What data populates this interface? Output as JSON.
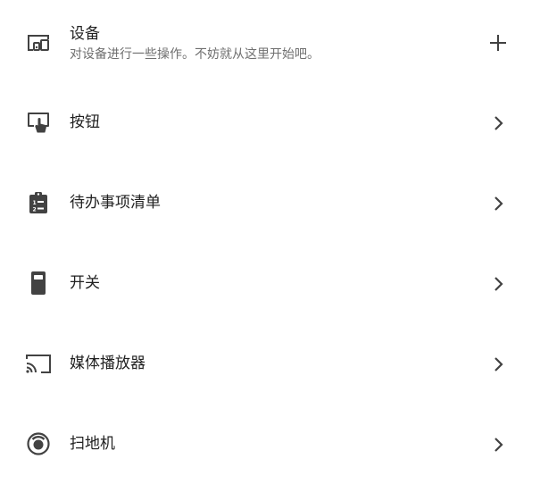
{
  "items": [
    {
      "label": "设备",
      "secondary": "对设备进行一些操作。不妨就从这里开始吧。",
      "icon": "devices-icon",
      "trailing": "add-icon"
    },
    {
      "label": "按钮",
      "icon": "touch-button-icon",
      "trailing": "chevron-right-icon"
    },
    {
      "label": "待办事项清单",
      "icon": "clipboard-list-icon",
      "trailing": "chevron-right-icon"
    },
    {
      "label": "开关",
      "icon": "switch-icon",
      "trailing": "chevron-right-icon"
    },
    {
      "label": "媒体播放器",
      "icon": "cast-icon",
      "trailing": "chevron-right-icon"
    },
    {
      "label": "扫地机",
      "icon": "robot-vacuum-icon",
      "trailing": "chevron-right-icon"
    }
  ],
  "colors": {
    "icon": "#424242",
    "text": "#212121",
    "secondary_text": "#6f6f6f",
    "background": "#ffffff"
  }
}
